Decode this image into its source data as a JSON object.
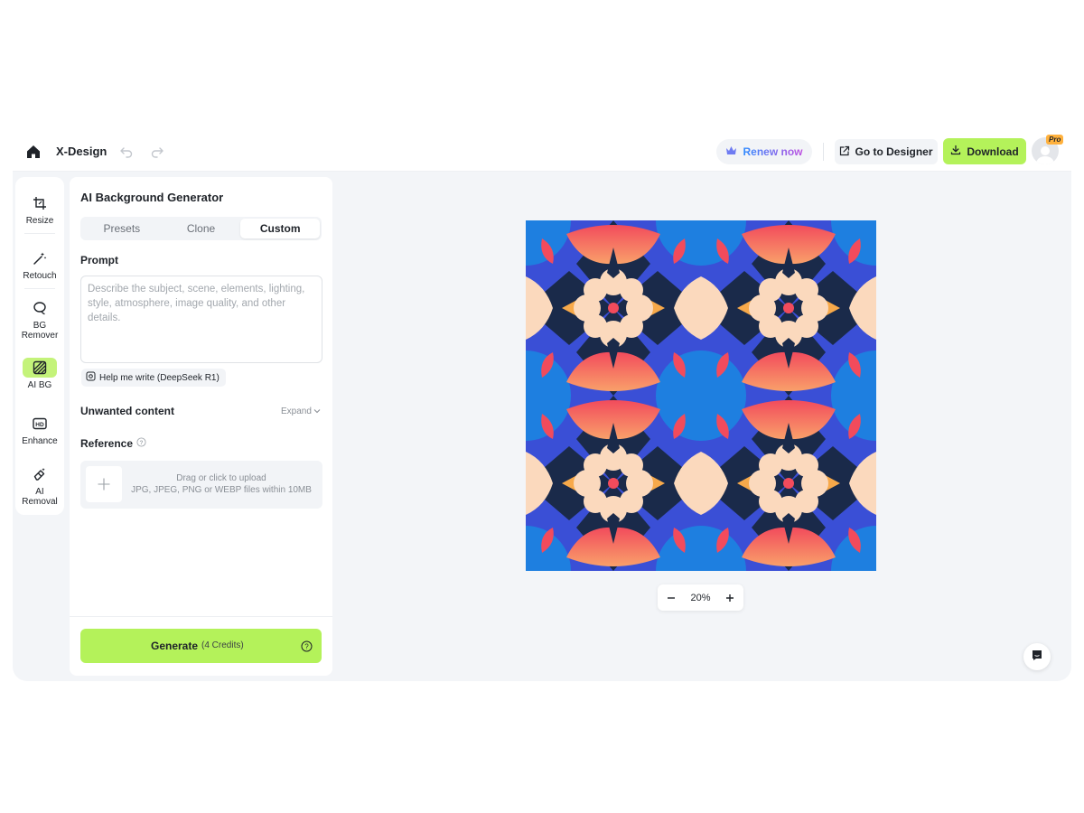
{
  "header": {
    "brand": "X-Design",
    "renew_label": "Renew now",
    "designer_label": "Go to Designer",
    "download_label": "Download",
    "pro_badge": "Pro"
  },
  "tools": [
    {
      "label": "Resize",
      "icon": "crop-icon"
    },
    {
      "label": "Retouch",
      "icon": "magic-wand-icon"
    },
    {
      "label": "BG Remover",
      "icon": "lasso-icon"
    },
    {
      "label": "AI BG",
      "icon": "stripes-icon",
      "active": true
    },
    {
      "label": "Enhance",
      "icon": "hd-icon"
    },
    {
      "label": "AI Removal",
      "icon": "eraser-icon"
    }
  ],
  "panel": {
    "title": "AI Background Generator",
    "tabs": [
      "Presets",
      "Clone",
      "Custom"
    ],
    "active_tab": "Custom",
    "prompt_label": "Prompt",
    "prompt_value": "",
    "prompt_placeholder": "Describe the subject, scene, elements, lighting, style, atmosphere, image quality, and other details.",
    "help_write": "Help me write (DeepSeek R1)",
    "unwanted_label": "Unwanted content",
    "expand_label": "Expand",
    "reference_label": "Reference",
    "upload_line1": "Drag or click to upload",
    "upload_line2": "JPG, JPEG, PNG or WEBP files within 10MB",
    "generate_label": "Generate",
    "generate_credits": "(4 Credits)"
  },
  "canvas": {
    "zoom": "20%"
  },
  "colors": {
    "accent": "#b4f25a",
    "navy": "#1a2a4a",
    "blue": "#3a4fd6",
    "sky": "#1e7fe0",
    "coral": "#f24b5c",
    "orange": "#f7a94a",
    "cream": "#fbd9bd"
  }
}
